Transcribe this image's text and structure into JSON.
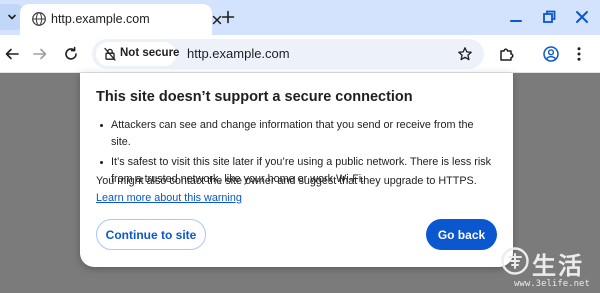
{
  "browser": {
    "tab": {
      "title": "http.example.com"
    },
    "omnibox": {
      "security_chip": "Not secure",
      "url": "http.example.com"
    },
    "icons": {
      "tab_menu": "chevron-down-icon",
      "favicon": "globe-icon",
      "tab_close": "close-icon",
      "new_tab": "plus-icon",
      "minimize": "minimize-icon",
      "restore": "restore-icon",
      "close_window": "close-icon",
      "back": "arrow-left-icon",
      "forward": "arrow-right-icon",
      "reload": "reload-icon",
      "not_secure": "lock-slash-icon",
      "bookmark": "star-icon",
      "extensions": "puzzle-icon",
      "profile": "account-icon",
      "menu": "kebab-menu-icon"
    }
  },
  "dialog": {
    "title": "This site doesn’t support a secure connection",
    "bullets": [
      "Attackers can see and change information that you send or receive from the site.",
      "It’s safest to visit this site later if you’re using a public network. There is less risk from a trusted network, like your home or work Wi-Fi."
    ],
    "contact_text": "You might also contact the site owner and suggest that they upgrade to HTTPS. ",
    "learn_more_link": "Learn more about this warning",
    "continue_button": "Continue to site",
    "back_button": "Go back"
  },
  "watermark": {
    "chinese": "生活",
    "url": "www.3elife.net"
  },
  "colors": {
    "tabstrip": "#d3e3fd",
    "accent": "#0b57d0",
    "backdrop": "#7b7b7b",
    "omnibox": "#edf2fa"
  }
}
